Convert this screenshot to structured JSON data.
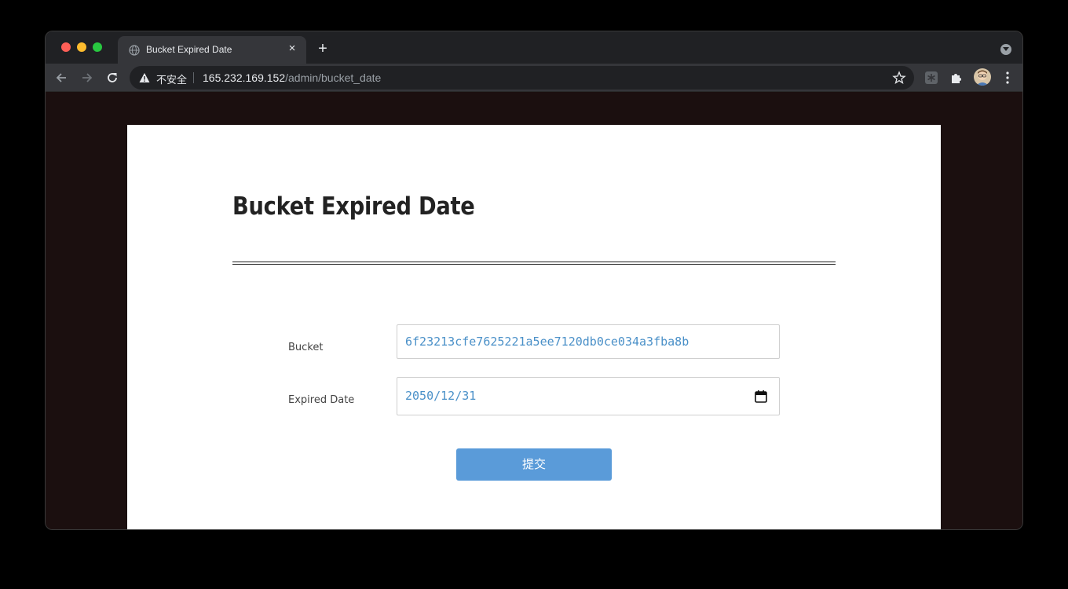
{
  "browser": {
    "tab_title": "Bucket Expired Date",
    "tab_close": "×",
    "new_tab": "+",
    "insecure_label": "不安全",
    "url_host": "165.232.169.152",
    "url_path": "/admin/bucket_date"
  },
  "icons": {
    "favicon": "globe-icon",
    "back": "back-arrow-icon",
    "forward": "forward-arrow-icon",
    "reload": "reload-icon",
    "warning": "warning-icon",
    "bookmark": "star-icon",
    "extension1": "extension-icon",
    "extensions": "puzzle-icon",
    "profile": "avatar",
    "menu": "kebab-menu-icon",
    "calendar": "calendar-icon"
  },
  "page": {
    "title": "Bucket Expired Date",
    "form": {
      "bucket_label": "Bucket",
      "bucket_value": "6f23213cfe7625221a5ee7120db0ce034a3fba8b",
      "date_label": "Expired Date",
      "date_value": "2050/12/31",
      "submit_label": "提交"
    }
  },
  "colors": {
    "page_background": "#1b0f0f",
    "card_background": "#ffffff",
    "input_text": "#4a90c8",
    "submit_button": "#5a9bd9",
    "browser_chrome": "#35363a"
  }
}
